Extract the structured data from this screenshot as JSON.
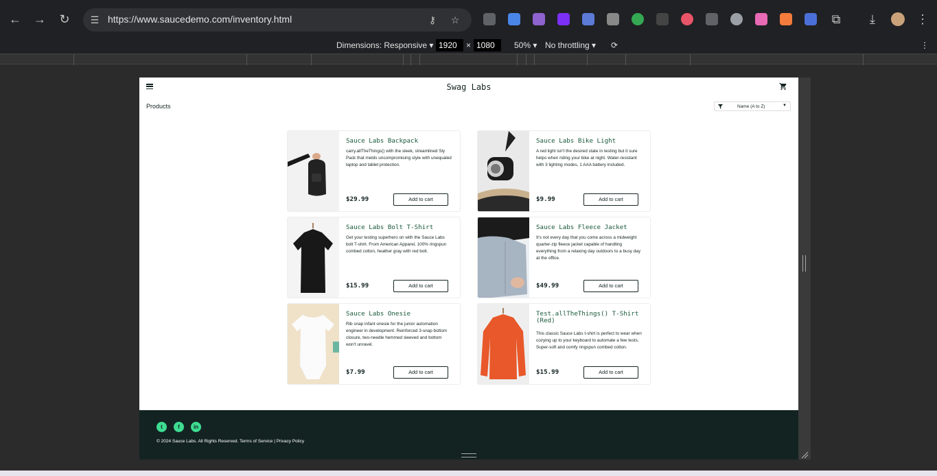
{
  "browser": {
    "url": "https://www.saucedemo.com/inventory.html"
  },
  "devtools": {
    "dimensions_label": "Dimensions: Responsive",
    "width": "1920",
    "times": "×",
    "height": "1080",
    "zoom": "50%",
    "throttling": "No throttling"
  },
  "app": {
    "logo": "Swag Labs",
    "page_title": "Products",
    "sort_selected": "Name (A to Z)"
  },
  "products": [
    {
      "name": "Sauce Labs Backpack",
      "desc": "carry.allTheThings() with the sleek, streamlined Sly Pack that melds uncompromising style with unequaled laptop and tablet protection.",
      "price": "$29.99",
      "button": "Add to cart"
    },
    {
      "name": "Sauce Labs Bike Light",
      "desc": "A red light isn't the desired state in testing but it sure helps when riding your bike at night. Water-resistant with 3 lighting modes, 1 AAA battery included.",
      "price": "$9.99",
      "button": "Add to cart"
    },
    {
      "name": "Sauce Labs Bolt T-Shirt",
      "desc": "Get your testing superhero on with the Sauce Labs bolt T-shirt. From American Apparel, 100% ringspun combed cotton, heather gray with red bolt.",
      "price": "$15.99",
      "button": "Add to cart"
    },
    {
      "name": "Sauce Labs Fleece Jacket",
      "desc": "It's not every day that you come across a midweight quarter-zip fleece jacket capable of handling everything from a relaxing day outdoors to a busy day at the office.",
      "price": "$49.99",
      "button": "Add to cart"
    },
    {
      "name": "Sauce Labs Onesie",
      "desc": "Rib snap infant onesie for the junior automation engineer in development. Reinforced 3-snap bottom closure, two-needle hemmed sleeved and bottom won't unravel.",
      "price": "$7.99",
      "button": "Add to cart"
    },
    {
      "name": "Test.allTheThings() T-Shirt (Red)",
      "desc": "This classic Sauce Labs t-shirt is perfect to wear when cozying up to your keyboard to automate a few tests. Super-soft and comfy ringspun combed cotton.",
      "price": "$15.99",
      "button": "Add to cart"
    }
  ],
  "footer": {
    "copyright": "© 2024 Sauce Labs. All Rights Reserved. Terms of Service | Privacy Policy",
    "social": [
      "twitter-icon",
      "facebook-icon",
      "linkedin-icon"
    ]
  },
  "colors": {
    "brand_dark": "#132322",
    "accent_green": "#3ddc91",
    "product_name": "#18583a"
  }
}
